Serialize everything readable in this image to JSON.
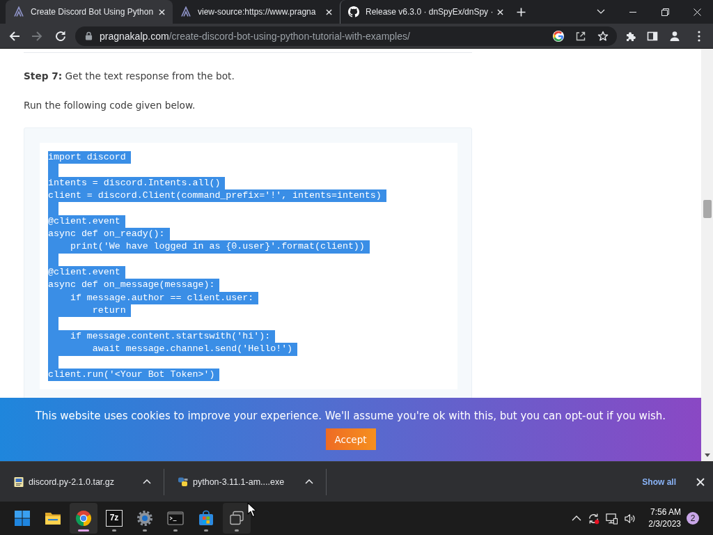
{
  "tabs": [
    {
      "title": "Create Discord Bot Using Python",
      "kind": "site",
      "selected": true
    },
    {
      "title": "view-source:https://www.pragna",
      "kind": "site",
      "selected": false
    },
    {
      "title": "Release v6.3.0 · dnSpyEx/dnSpy ·",
      "kind": "repo",
      "selected": false
    }
  ],
  "toolbar": {
    "nav": [
      {
        "kind": "back",
        "disabled": false
      },
      {
        "kind": "forward",
        "disabled": true
      },
      {
        "kind": "reload",
        "disabled": false
      }
    ],
    "address": {
      "host": "pragnakalp.com",
      "path": "/create-discord-bot-using-python-tutorial-with-examples/"
    }
  },
  "article": {
    "paragraphs": [
      "**Step 7:** Get the text response from the bot.",
      "Run the following code given below."
    ],
    "code": {
      "selected": true,
      "text": "import discord\n\nintents = discord.Intents.all()\nclient = discord.Client(command_prefix='!', intents=intents)\n\n@client.event\nasync def on_ready():\n    print('We have logged in as {0.user}'.format(client))\n\n@client.event\nasync def on_message(message):\n    if message.author == client.user:\n        return\n\n    if message.content.startswith('hi'):\n        await message.channel.send('Hello!')\n\nclient.run('<Your Bot Token>')"
    }
  },
  "cookie_banner": {
    "message": "This website uses cookies to improve your experience. We'll assume you're ok with this, but you can opt-out if you wish.",
    "button": "Accept"
  },
  "downloads": {
    "items": [
      {
        "filename": "discord.py-2.1.0.tar.gz",
        "kind": "archive"
      },
      {
        "filename": "python-3.11.1-am....exe",
        "kind": "installer"
      }
    ],
    "show_all": "Show all"
  },
  "taskbar": {
    "apps": [
      {
        "kind": "explorer",
        "running": false,
        "selected": false,
        "hovered": false
      },
      {
        "kind": "browser",
        "running": true,
        "selected": true,
        "hovered": false
      },
      {
        "kind": "archiver",
        "label": "7z",
        "running": true,
        "selected": false,
        "hovered": false
      },
      {
        "kind": "settings",
        "running": true,
        "selected": false,
        "hovered": false
      },
      {
        "kind": "terminal",
        "running": true,
        "selected": false,
        "hovered": false
      },
      {
        "kind": "store",
        "running": true,
        "selected": false,
        "hovered": false
      },
      {
        "kind": "windows",
        "running": true,
        "selected": false,
        "hovered": true
      }
    ],
    "time": "7:56 AM",
    "date": "2/3/2023",
    "notifications": "2"
  }
}
